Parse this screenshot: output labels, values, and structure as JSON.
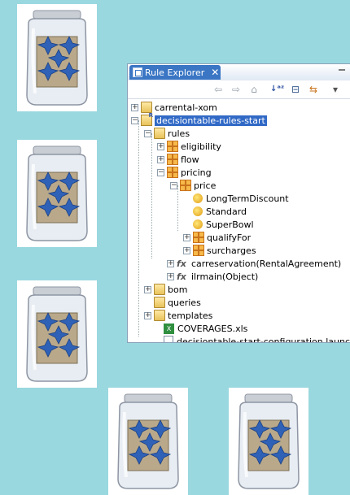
{
  "panel": {
    "title": "Rule Explorer",
    "close_glyph": "✕",
    "toolbar": [
      "back-icon",
      "forward-icon",
      "home-icon",
      "sort-az-icon",
      "collapse-all-icon",
      "link-editor-icon",
      "view-menu-icon"
    ]
  },
  "tree": {
    "carrental_xom": "carrental-xom",
    "project": "decisiontable-rules-start",
    "rules": "rules",
    "eligibility": "eligibility",
    "flow": "flow",
    "pricing": "pricing",
    "price": "price",
    "long_term_discount": "LongTermDiscount",
    "standard": "Standard",
    "superbowl": "SuperBowl",
    "qualify_for": "qualifyFor",
    "surcharges": "surcharges",
    "carreservation": "carreservation(RentalAgreement)",
    "ilrmain": "ilrmain(Object)",
    "bom": "bom",
    "queries": "queries",
    "templates": "templates",
    "coverages": "COVERAGES.xls",
    "launch": "decisiontable-start-configuration.launch"
  },
  "jar_icon": "jar-of-ruleset-icon"
}
